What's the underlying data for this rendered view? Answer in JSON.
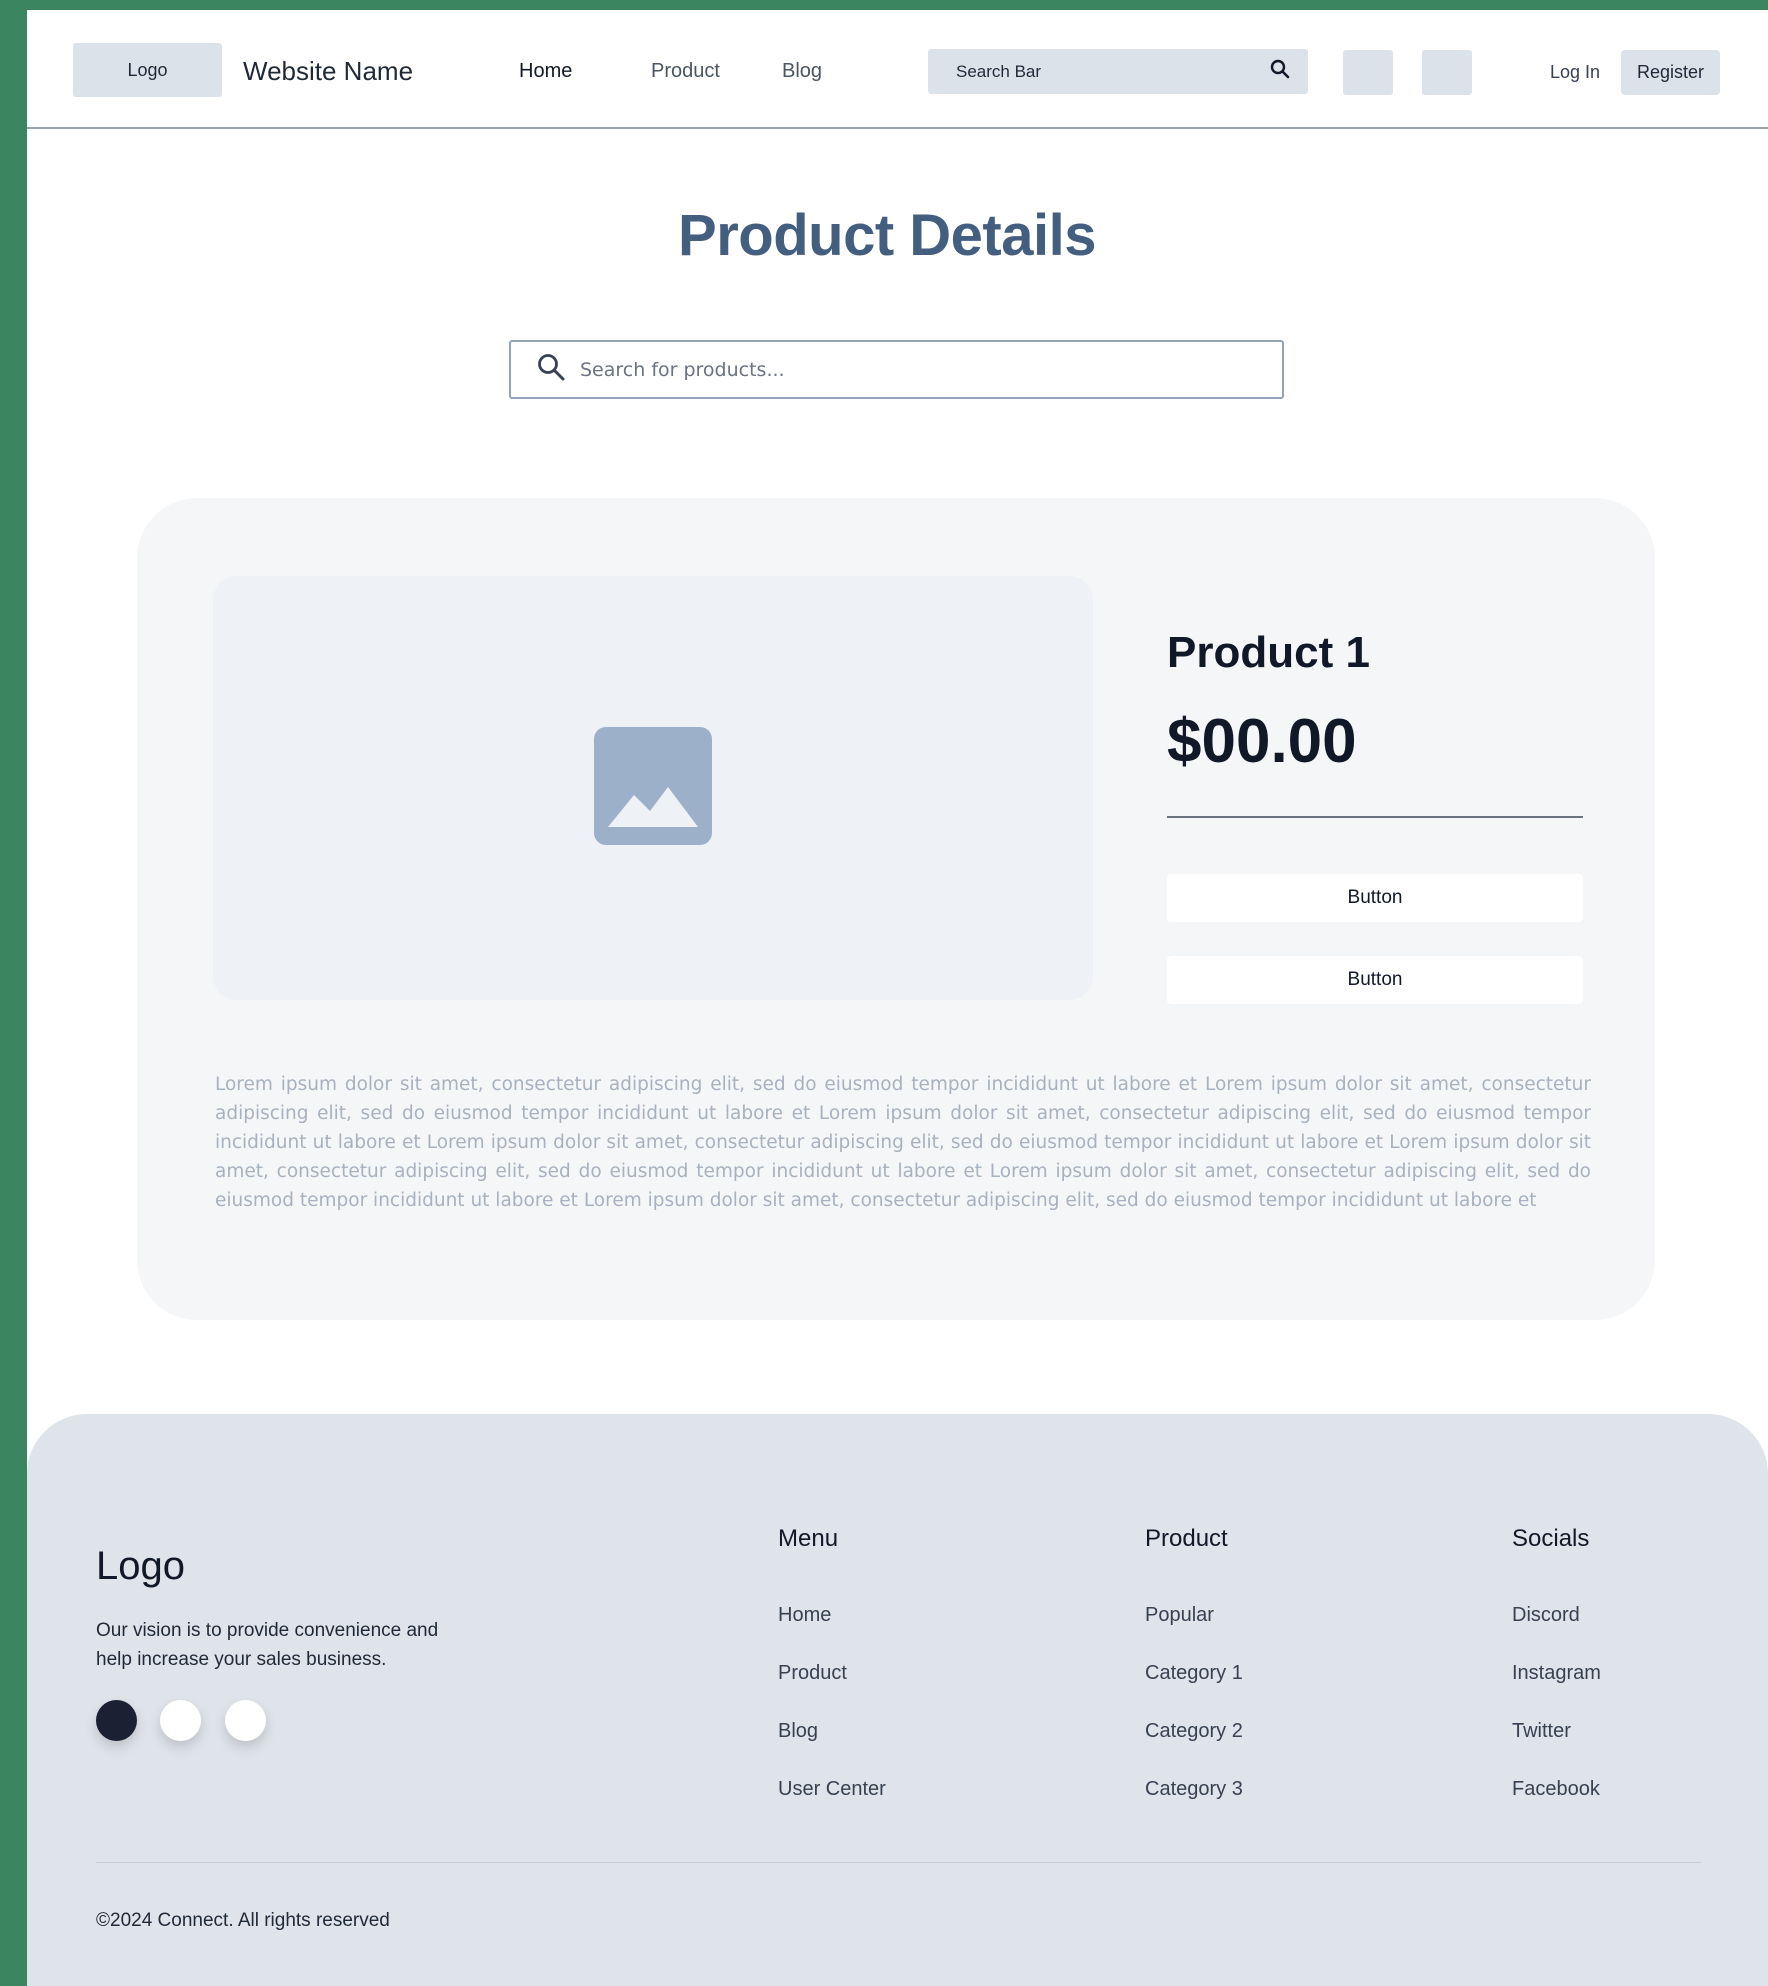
{
  "header": {
    "logo": "Logo",
    "site_name": "Website Name",
    "nav": [
      {
        "label": "Home"
      },
      {
        "label": "Product"
      },
      {
        "label": "Blog"
      }
    ],
    "search_label": "Search Bar",
    "search_icon": "search-icon",
    "login": "Log In",
    "register": "Register"
  },
  "main": {
    "title": "Product Details",
    "search_placeholder": "Search for products...",
    "product": {
      "name": "Product 1",
      "price": "$00.00",
      "image_icon": "image-placeholder-icon",
      "buttons": [
        {
          "label": "Button"
        },
        {
          "label": "Button"
        }
      ],
      "description": "Lorem ipsum dolor sit amet, consectetur adipiscing elit, sed do eiusmod tempor incididunt ut labore et Lorem ipsum dolor sit amet, consectetur adipiscing elit, sed do eiusmod tempor incididunt ut labore et Lorem ipsum dolor sit amet, consectetur adipiscing elit, sed do eiusmod tempor incididunt ut labore et Lorem ipsum dolor sit amet, consectetur adipiscing elit, sed do eiusmod tempor incididunt ut labore et Lorem ipsum dolor sit amet, consectetur adipiscing elit, sed do eiusmod tempor incididunt ut labore et Lorem ipsum dolor sit amet, consectetur adipiscing elit, sed do eiusmod tempor incididunt ut labore et Lorem ipsum dolor sit amet, consectetur adipiscing elit, sed do eiusmod tempor incididunt ut labore et"
    }
  },
  "footer": {
    "logo": "Logo",
    "vision": "Our vision is to provide convenience and help increase your sales business.",
    "dots": [
      {
        "color": "#1b2033"
      },
      {
        "color": "#ffffff"
      },
      {
        "color": "#ffffff"
      }
    ],
    "columns": [
      {
        "heading": "Menu",
        "items": [
          "Home",
          "Product",
          "Blog",
          "User Center"
        ]
      },
      {
        "heading": "Product",
        "items": [
          "Popular",
          "Category 1",
          "Category 2",
          "Category 3"
        ]
      },
      {
        "heading": "Socials",
        "items": [
          "Discord",
          "Instagram",
          "Twitter",
          "Facebook"
        ]
      }
    ],
    "copyright": "©2024 Connect. All rights reserved"
  },
  "colors": {
    "frame": "#3b8560",
    "title": "#445e80",
    "placeholder_block": "#dbe2ea",
    "footer_bg": "#dfe3ea",
    "card_bg": "#f5f6f8",
    "image_icon": "#9db0ca"
  }
}
